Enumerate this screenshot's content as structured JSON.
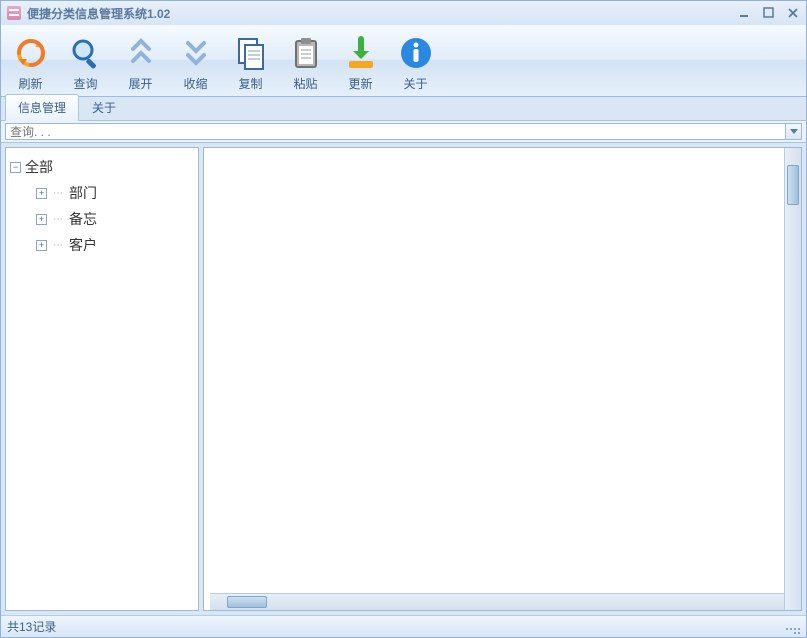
{
  "window": {
    "title": "便捷分类信息管理系统1.02"
  },
  "toolbar": {
    "refresh": "刷新",
    "query": "查询",
    "expand": "展开",
    "collapse": "收缩",
    "copy": "复制",
    "paste": "粘贴",
    "update": "更新",
    "about": "关于"
  },
  "tabs": {
    "info_mgmt": "信息管理",
    "about": "关于"
  },
  "search": {
    "placeholder": "查询. . ."
  },
  "tree": {
    "root": "全部",
    "children": [
      "部门",
      "备忘",
      "客户"
    ]
  },
  "status": {
    "text": "共13记录"
  }
}
